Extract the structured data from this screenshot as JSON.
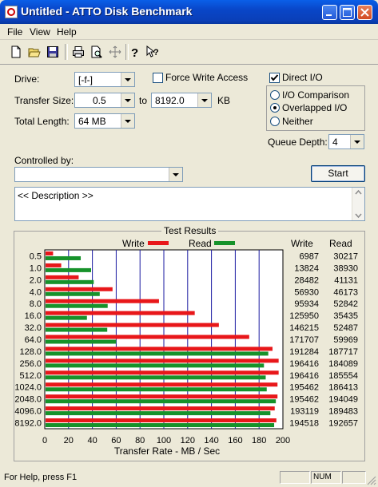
{
  "window": {
    "title": "Untitled - ATTO Disk Benchmark"
  },
  "menu": {
    "file": "File",
    "view": "View",
    "help": "Help"
  },
  "form": {
    "drive_label": "Drive:",
    "drive_value": "[-f-]",
    "force_write_label": "Force Write Access",
    "force_write_checked": false,
    "direct_io_label": "Direct I/O",
    "direct_io_checked": true,
    "transfer_size_label": "Transfer Size:",
    "transfer_from": "0.5",
    "transfer_to_label": "to",
    "transfer_to": "8192.0",
    "transfer_unit": "KB",
    "total_length_label": "Total Length:",
    "total_length_value": "64 MB",
    "io_comparison_label": "I/O Comparison",
    "overlapped_io_label": "Overlapped I/O",
    "neither_label": "Neither",
    "selected_mode": "Overlapped I/O",
    "queue_depth_label": "Queue Depth:",
    "queue_depth_value": "4",
    "controlled_by_label": "Controlled by:",
    "controlled_by_value": "",
    "start_label": "Start",
    "description_text": "<< Description >>"
  },
  "results": {
    "group_title": "Test Results",
    "write_col": "Write",
    "read_col": "Read"
  },
  "status": {
    "help_text": "For Help, press F1",
    "num": "NUM"
  },
  "colors": {
    "write": "#e8171a",
    "read": "#16922a",
    "grid": "#1a1aa0"
  },
  "chart_data": {
    "type": "bar",
    "orientation": "horizontal",
    "legend": [
      "Write",
      "Read"
    ],
    "categories": [
      "0.5",
      "1.0",
      "2.0",
      "4.0",
      "8.0",
      "16.0",
      "32.0",
      "64.0",
      "128.0",
      "256.0",
      "512.0",
      "1024.0",
      "2048.0",
      "4096.0",
      "8192.0"
    ],
    "series": [
      {
        "name": "Write",
        "values": [
          6987,
          13824,
          28482,
          56930,
          95934,
          125950,
          146215,
          171707,
          191284,
          196416,
          196416,
          195462,
          195462,
          193119,
          194518
        ],
        "labels": [
          "6987",
          "13824",
          "28482",
          "56930",
          "95934",
          "125950",
          "146215",
          "171707",
          "191284",
          "196416",
          "196416",
          "195462",
          "195462",
          "193119",
          "194518"
        ]
      },
      {
        "name": "Read",
        "values": [
          30217,
          38930,
          41131,
          46173,
          52842,
          35435,
          52487,
          59969,
          187717,
          184089,
          185554,
          186413,
          194049,
          189483,
          192657
        ],
        "labels": [
          "30217",
          "38930",
          "41131",
          "46173",
          "52842",
          "35435",
          "52487",
          "59969",
          "187717",
          "184089",
          "185554",
          "186413",
          "194049",
          "189483",
          "192657"
        ]
      }
    ],
    "xlabel": "Transfer Rate - MB / Sec",
    "xticks": [
      "0",
      "20",
      "40",
      "60",
      "80",
      "100",
      "120",
      "140",
      "160",
      "180",
      "200"
    ],
    "xlim": [
      0,
      200
    ],
    "grid": true
  }
}
